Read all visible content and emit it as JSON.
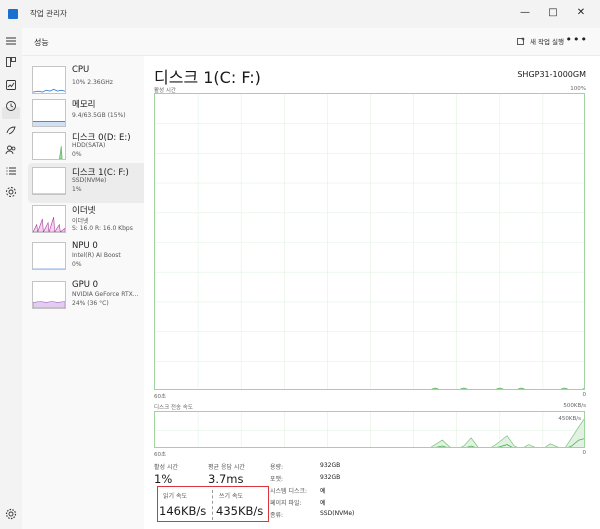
{
  "window": {
    "title": "작업 관리자"
  },
  "toolbar": {
    "title": "성능",
    "new_task": "새 작업 실행",
    "more": "•••"
  },
  "devices": [
    {
      "name": "CPU",
      "sub1": "10% 2.36GHz",
      "sub2": ""
    },
    {
      "name": "메모리",
      "sub1": "9.4/63.5GB (15%)",
      "sub2": ""
    },
    {
      "name": "디스크 0(D: E:)",
      "sub1": "HDD(SATA)",
      "sub2": "0%"
    },
    {
      "name": "디스크 1(C: F:)",
      "sub1": "SSD(NVMe)",
      "sub2": "1%"
    },
    {
      "name": "이더넷",
      "sub1": "이더넷",
      "sub2": "S: 16.0  R: 16.0 Kbps"
    },
    {
      "name": "NPU 0",
      "sub1": "Intel(R) AI Boost",
      "sub2": "0%"
    },
    {
      "name": "GPU 0",
      "sub1": "NVIDIA GeForce RTX...",
      "sub2": "24% (36 °C)"
    }
  ],
  "detail": {
    "title": "디스크 1(C: F:)",
    "model": "SHGP31-1000GM",
    "active_chart": {
      "label": "활성 시간",
      "max": "100%",
      "time_left": "60초",
      "time_right": "0"
    },
    "transfer_chart": {
      "label": "디스크 전송 속도",
      "max": "500KB/s",
      "inner": "450KB/s",
      "time_left": "60초",
      "time_right": "0"
    }
  },
  "stats": {
    "active_label": "활성 시간",
    "active_value": "1%",
    "response_label": "평균 응답 시간",
    "response_value": "3.7ms",
    "read_label": "읽기 속도",
    "read_value": "146KB/s",
    "write_label": "쓰기 속도",
    "write_value": "435KB/s"
  },
  "info": [
    {
      "label": "용량:",
      "value": "932GB"
    },
    {
      "label": "포맷:",
      "value": "932GB"
    },
    {
      "label": "시스템 디스크:",
      "value": "예"
    },
    {
      "label": "페이지 파일:",
      "value": "예"
    },
    {
      "label": "종류:",
      "value": "SSD(NVMe)"
    }
  ],
  "colors": {
    "disk_green": "#4caf50",
    "chart_border": "#9fd39f",
    "highlight": "#d9363e",
    "cpu_blue": "#1b6fd1",
    "ethernet_purple": "#a7339a"
  },
  "chart_data": [
    {
      "type": "area",
      "title": "활성 시간",
      "x": [
        0,
        1,
        2,
        3,
        4,
        5,
        6,
        7,
        8,
        9,
        10,
        11,
        12,
        13,
        14,
        15,
        16,
        17,
        18,
        19,
        20,
        21,
        22,
        23,
        24,
        25,
        26,
        27,
        28,
        29,
        30,
        31,
        32,
        33,
        34,
        35,
        36,
        37,
        38,
        39,
        40,
        41,
        42,
        43,
        44,
        45,
        46,
        47,
        48,
        49,
        50,
        51,
        52,
        53,
        54,
        55,
        56,
        57,
        58,
        59,
        60
      ],
      "series": [
        {
          "values": [
            0,
            0,
            0,
            0,
            0,
            0,
            0,
            0,
            0,
            0,
            0,
            0,
            0,
            0,
            0,
            0,
            0,
            0,
            0,
            0,
            0,
            0,
            0,
            0,
            0,
            0,
            0,
            0,
            0,
            0,
            0,
            0,
            0,
            0,
            0,
            0,
            0,
            0,
            0,
            1,
            0,
            0,
            0,
            1,
            0,
            0,
            0,
            0,
            1,
            0,
            0,
            1,
            0,
            0,
            0,
            0,
            0,
            1,
            0,
            0,
            1
          ]
        }
      ],
      "ylim": [
        0,
        100
      ]
    },
    {
      "type": "line",
      "title": "디스크 전송 속도",
      "x": [
        0,
        1,
        2,
        3,
        4,
        5,
        6,
        7,
        8,
        9,
        10,
        11,
        12,
        13,
        14,
        15,
        16,
        17,
        18,
        19,
        20,
        21,
        22,
        23,
        24,
        25,
        26,
        27,
        28,
        29,
        30,
        31,
        32,
        33,
        34,
        35,
        36,
        37,
        38,
        39,
        40,
        41,
        42,
        43,
        44,
        45,
        46,
        47,
        48,
        49,
        50,
        51,
        52,
        53,
        54,
        55,
        56,
        57,
        58,
        59,
        60
      ],
      "series": [
        {
          "values": [
            0,
            0,
            0,
            0,
            0,
            0,
            0,
            0,
            0,
            0,
            0,
            0,
            0,
            0,
            0,
            0,
            0,
            0,
            0,
            0,
            0,
            0,
            0,
            0,
            0,
            0,
            0,
            0,
            0,
            0,
            0,
            0,
            0,
            0,
            0,
            0,
            0,
            0,
            0,
            60,
            120,
            30,
            0,
            40,
            150,
            20,
            0,
            30,
            100,
            180,
            40,
            0,
            60,
            20,
            0,
            70,
            30,
            0,
            150,
            300,
            440
          ]
        },
        {
          "values": [
            0,
            0,
            0,
            0,
            0,
            0,
            0,
            0,
            0,
            0,
            0,
            0,
            0,
            0,
            0,
            0,
            0,
            0,
            0,
            0,
            0,
            0,
            0,
            0,
            0,
            0,
            0,
            0,
            0,
            0,
            0,
            0,
            0,
            0,
            0,
            0,
            0,
            0,
            0,
            20,
            40,
            10,
            0,
            10,
            40,
            5,
            0,
            10,
            30,
            60,
            10,
            0,
            20,
            5,
            0,
            20,
            10,
            0,
            40,
            120,
            146
          ]
        }
      ],
      "ylim": [
        0,
        500
      ]
    }
  ]
}
